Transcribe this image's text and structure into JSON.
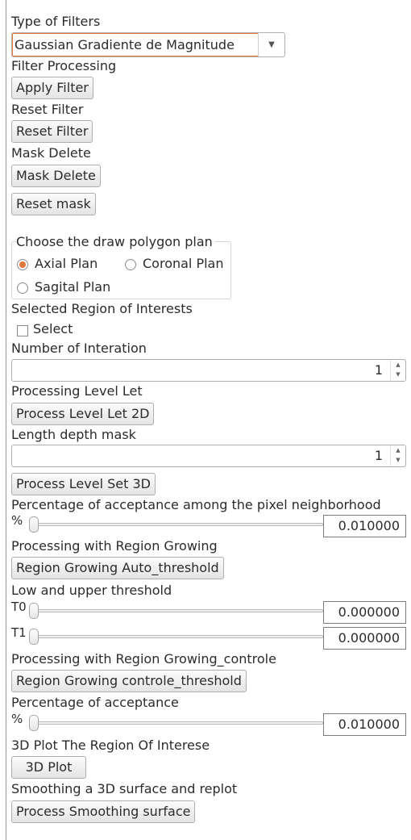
{
  "filters": {
    "type_label": "Type of Filters",
    "selected": "Gaussian Gradiente de Magnitude",
    "processing_label": "Filter Processing",
    "apply_button": "Apply Filter",
    "reset_label": "Reset Filter",
    "reset_button": "Reset Filter"
  },
  "mask": {
    "label": "Mask Delete",
    "delete_button": "Mask Delete",
    "reset_button": "Reset mask"
  },
  "polygon_plan": {
    "title": "Choose the draw polygon plan",
    "axial": "Axial Plan",
    "coronal": "Coronal Plan",
    "sagital": "Sagital Plan",
    "selected": "Axial Plan"
  },
  "roi": {
    "label": "Selected Region of Interests",
    "select_checkbox": "Select",
    "checked": false
  },
  "iterations": {
    "label": "Number of Interation",
    "value": "1"
  },
  "level_set_2d": {
    "label": "Processing Level Let",
    "button": "Process Level Let 2D"
  },
  "depth_mask": {
    "label": "Length depth mask",
    "value": "1",
    "button": "Process Level Set 3D"
  },
  "neighborhood": {
    "label": "Percentage of acceptance among the pixel neighborhood",
    "prefix": "%",
    "value": "0.010000"
  },
  "region_growing": {
    "label": "Processing with Region Growing",
    "button": "Region Growing Auto_threshold"
  },
  "thresholds": {
    "label": "Low and upper threshold",
    "t0_prefix": "T0",
    "t0_value": "0.000000",
    "t1_prefix": "T1",
    "t1_value": "0.000000"
  },
  "region_growing_control": {
    "label": "Processing with Region Growing_controle",
    "button": "Region Growing controle_threshold"
  },
  "acceptance": {
    "label": "Percentage of acceptance",
    "prefix": "%",
    "value": "0.010000"
  },
  "plot3d": {
    "label": "3D Plot The Region Of Interese",
    "button": "3D Plot"
  },
  "smoothing": {
    "label": "Smoothing a 3D surface and replot",
    "button": "Process Smoothing surface"
  },
  "colors": {
    "accent": "#e2753b",
    "border": "#aeaeae",
    "text": "#2b2b2b"
  }
}
